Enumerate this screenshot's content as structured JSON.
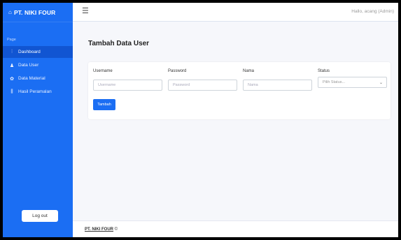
{
  "sidebar": {
    "brand_icon": "⌂",
    "brand": "PT. NIKI FOUR",
    "section_label": "Page",
    "items": [
      {
        "label": "Dashboard",
        "icon": "chart-icon",
        "glyph": "⫶",
        "active": true
      },
      {
        "label": "Data User",
        "icon": "user-icon",
        "glyph": "♟",
        "active": false
      },
      {
        "label": "Data Material",
        "icon": "palette-icon",
        "glyph": "✿",
        "active": false
      },
      {
        "label": "Hasil Peramalan",
        "icon": "bar-chart-icon",
        "glyph": "⫼",
        "active": false
      }
    ],
    "logout_label": "Log out"
  },
  "topbar": {
    "menu_glyph": "☰",
    "greeting": "Hallo, acang (Admin)"
  },
  "main": {
    "title_bold": "Tambah Data",
    "title_rest": " User",
    "form": {
      "username_label": "Username",
      "username_placeholder": "Username",
      "password_label": "Password",
      "password_placeholder": "Password",
      "nama_label": "Nama",
      "nama_placeholder": "Nama",
      "status_label": "Status",
      "status_selected": "Pilih Status...",
      "chevron_glyph": "⌄",
      "submit_label": "Tambah"
    }
  },
  "footer": {
    "brand": "PT. NIKI FOUR",
    "copyright": " ©"
  },
  "colors": {
    "accent": "#1b6ef3",
    "background": "#f6f7fb"
  }
}
